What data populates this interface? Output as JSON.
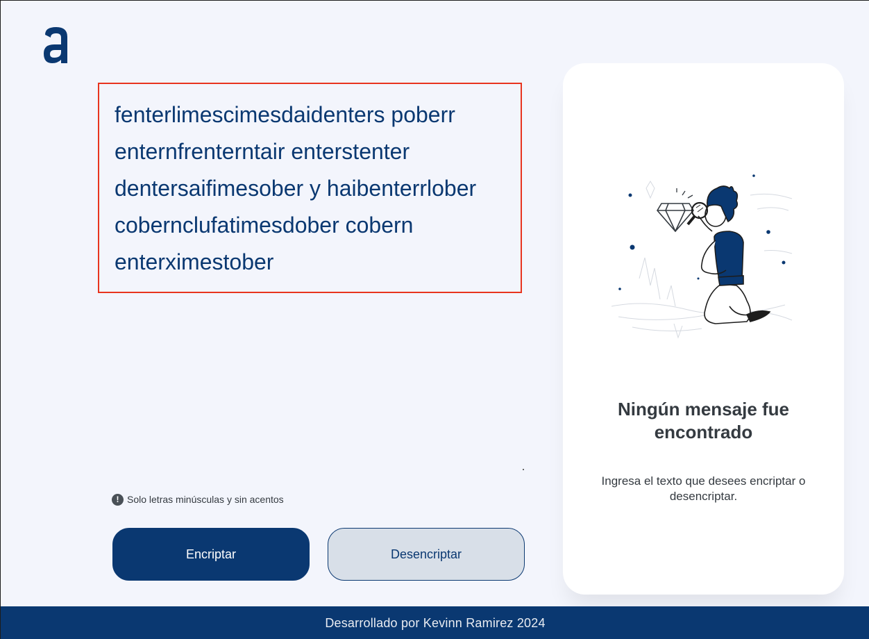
{
  "logo": {
    "icon": "alura-a-logo-icon"
  },
  "input": {
    "value": "fenterlimescimesdaidenters poberr enternfrenterntair enterstenter dentersaifimesober y haibenterrlober cobernclufatimesdober cobern enterximestober"
  },
  "note": {
    "icon": "exclamation-circle-icon",
    "icon_glyph": "!",
    "text": "Solo letras minúsculas y sin acentos"
  },
  "buttons": {
    "encrypt_label": "Encriptar",
    "decrypt_label": "Desencriptar"
  },
  "output_panel": {
    "illustration": "person-with-magnifying-glass-illustration",
    "title": "Ningún mensaje fue encontrado",
    "description": "Ingresa el texto que desees encriptar o desencriptar."
  },
  "footer": {
    "text": "Desarrollado por Kevinn Ramirez 2024"
  },
  "colors": {
    "primary": "#0A3871",
    "background": "#F3F5FC",
    "secondary_button": "#D8DFE8",
    "focus_border": "#E8341E",
    "text_dark": "#343A40"
  }
}
